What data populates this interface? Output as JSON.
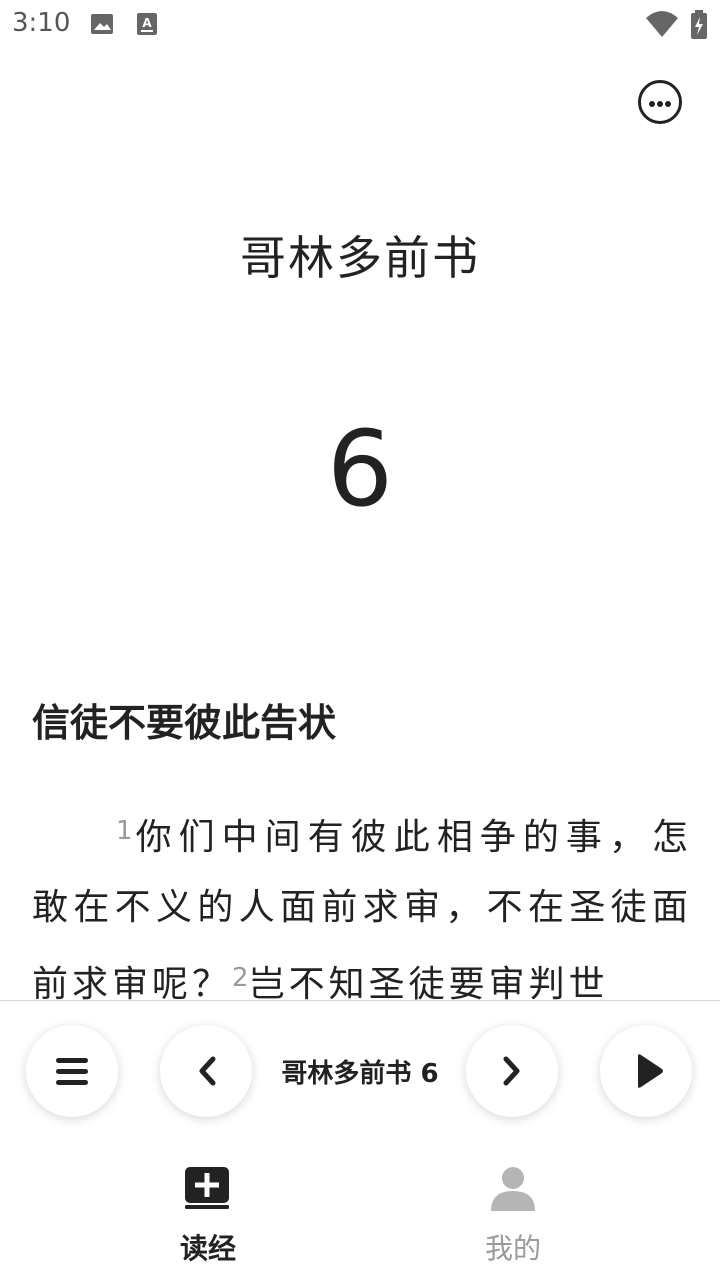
{
  "status_bar": {
    "time": "3:10"
  },
  "header": {
    "more_icon": "more-horizontal-circle-icon"
  },
  "book": {
    "title": "哥林多前书",
    "chapter": "6"
  },
  "content": {
    "section_heading": "信徒不要彼此告状",
    "verses": [
      {
        "num": "1",
        "text": "你们中间有彼此相争的事，怎敢在不义的人面前求审，不在圣徒面前求审呢？"
      },
      {
        "num": "2",
        "text": "岂不知圣徒要审判世"
      }
    ]
  },
  "player": {
    "chapter_label": "哥林多前书 6",
    "menu_icon": "menu-icon",
    "prev_icon": "chevron-left-icon",
    "next_icon": "chevron-right-icon",
    "play_icon": "play-icon"
  },
  "tabs": [
    {
      "label": "读经",
      "icon": "book-plus-icon",
      "active": true,
      "color": "#222222"
    },
    {
      "label": "我的",
      "icon": "person-icon",
      "active": false,
      "color": "#9a9a9a"
    }
  ]
}
